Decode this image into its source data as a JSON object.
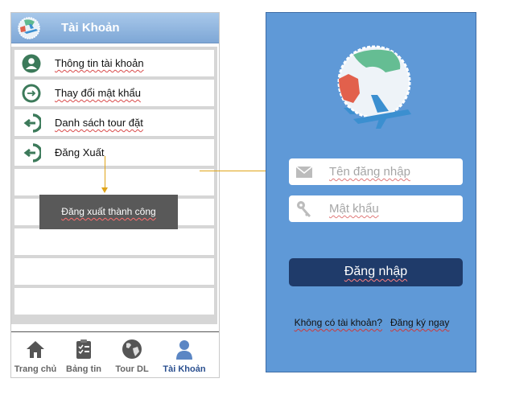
{
  "left_screen": {
    "header": {
      "title": "Tài Khoản"
    },
    "menu": [
      {
        "label": "Thông tin tài khoản",
        "icon": "user-icon"
      },
      {
        "label": "Thay đổi mật khẩu",
        "icon": "arrow-right-circle-icon"
      },
      {
        "label": "Danh sách tour đặt",
        "icon": "logout-icon"
      },
      {
        "label": "Đăng Xuất",
        "icon": "logout-icon"
      }
    ],
    "toast": "Đăng xuất thành công",
    "nav": [
      {
        "label": "Trang chủ",
        "icon": "home-icon"
      },
      {
        "label": "Bảng tin",
        "icon": "clipboard-icon"
      },
      {
        "label": "Tour DL",
        "icon": "globe-icon"
      },
      {
        "label": "Tài Khoản",
        "icon": "user-icon",
        "active": true
      }
    ]
  },
  "right_screen": {
    "username_placeholder": "Tên đăng nhập",
    "password_placeholder": "Mật khẩu",
    "login_button": "Đăng nhập",
    "register_prompt": "Không có tài khoản?",
    "register_link": "Đăng ký ngay"
  },
  "colors": {
    "header_blue": "#7ea7d6",
    "login_bg": "#5f99d7",
    "login_button": "#1f3b6a",
    "icon_green": "#3c7a5a",
    "arrow": "#e0a419"
  }
}
